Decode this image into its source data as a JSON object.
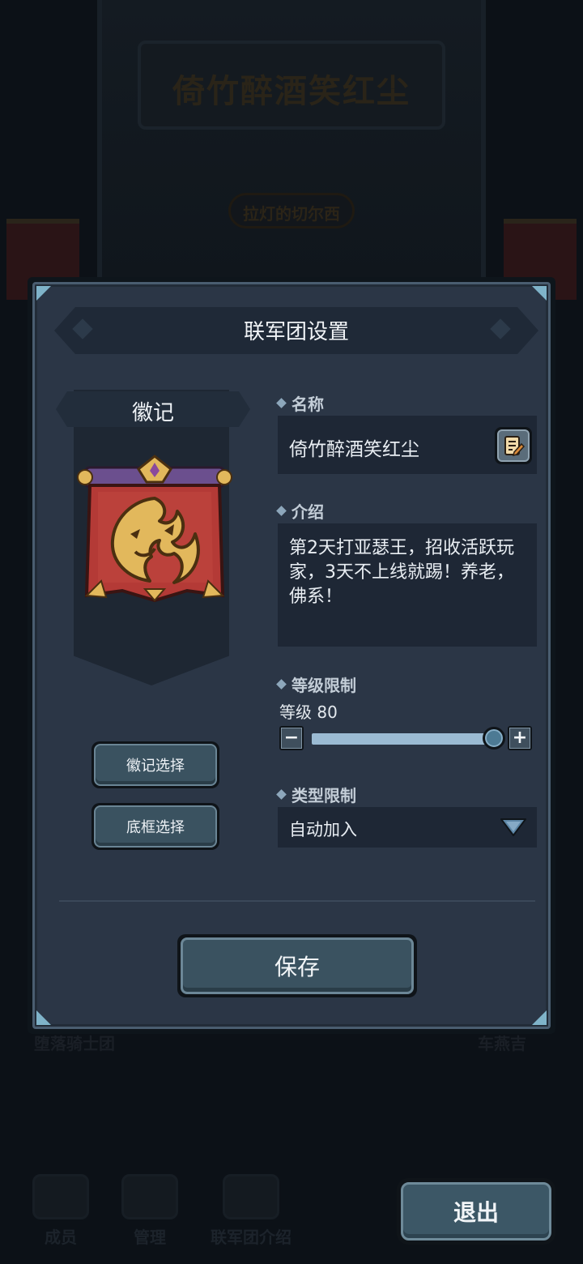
{
  "background": {
    "guild_title": "倚竹醉酒笑红尘",
    "subtitle": "拉灯的切尔西",
    "left_name": "堕落骑士团",
    "right_name": "车燕吉",
    "nav": [
      {
        "label": "成员",
        "icon": "members-icon"
      },
      {
        "label": "管理",
        "icon": "manage-icon"
      },
      {
        "label": "联军团介绍",
        "icon": "intro-icon"
      }
    ]
  },
  "modal": {
    "title": "联军团设置",
    "emblem_label": "徽记",
    "emblem_select_label": "徽记选择",
    "frame_select_label": "底框选择",
    "name_label": "名称",
    "name_value": "倚竹醉酒笑红尘",
    "intro_label": "介绍",
    "intro_value": "第2天打亚瑟王，招收活跃玩家，3天不上线就踢！养老，佛系！",
    "level_label": "等级限制",
    "level_text": "等级 80",
    "level_value": 80,
    "level_fill_fraction": 0.98,
    "type_label": "类型限制",
    "type_value": "自动加入",
    "save_label": "保存"
  },
  "exit_label": "退出",
  "colors": {
    "panel": "#2b3646",
    "field": "#1e2735",
    "button": "#3a5260",
    "slider_fill": "#9bbbd3",
    "flag_red": "#b43a36",
    "emblem_gold": "#e2b85c"
  }
}
